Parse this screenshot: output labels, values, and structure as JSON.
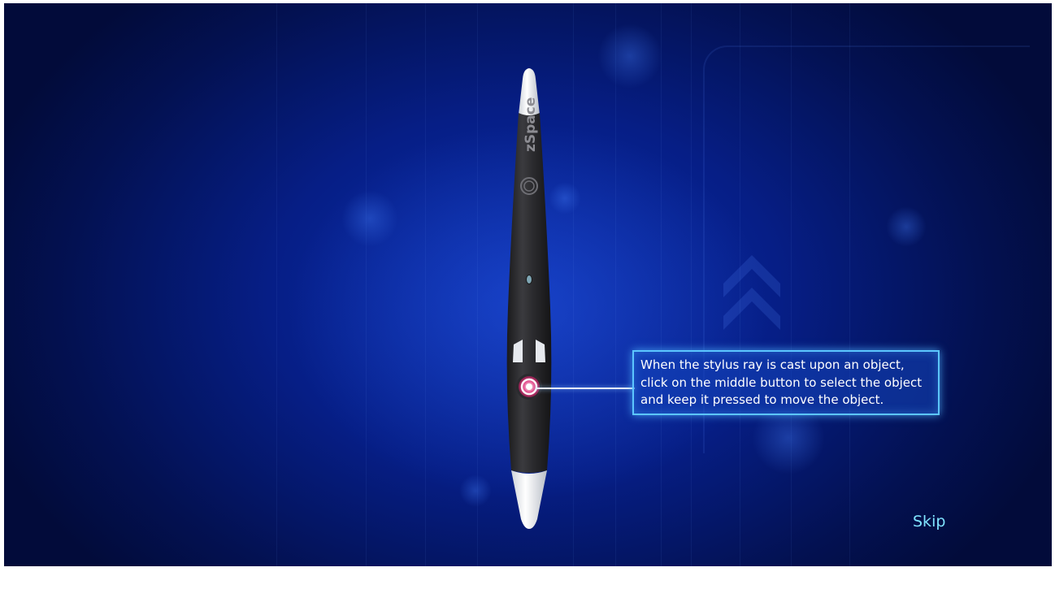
{
  "tutorial": {
    "device_brand": "zSpace",
    "instruction": "When the stylus ray is cast upon an object, click on the middle button to select the object and keep it pressed to move the object.",
    "skip_label": "Skip"
  },
  "colors": {
    "background": "#061e86",
    "callout_border": "#5cc6ff",
    "skip_text": "#7fe3ff",
    "stylus_body": "#2b2b2e",
    "middle_button_ring": "#c4306a"
  },
  "icons": {
    "highlighted_button": "middle-button-icon"
  }
}
